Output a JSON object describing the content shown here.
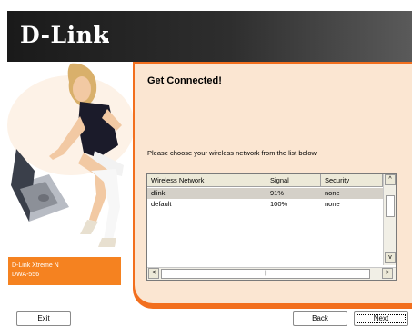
{
  "header": {
    "logo_text": "D-Link"
  },
  "sidebar": {
    "model_line1": "D-Link Xtreme N",
    "model_line2": "DWA-556"
  },
  "main": {
    "title": "Get Connected!",
    "instruction": "Please choose your wireless network from the list below."
  },
  "network_list": {
    "columns": [
      "Wireless Network",
      "Signal",
      "Security"
    ],
    "rows": [
      {
        "name": "dlink",
        "signal": "91%",
        "security": "none",
        "selected": true
      },
      {
        "name": "default",
        "signal": "100%",
        "security": "none",
        "selected": false
      }
    ],
    "scroll_up_glyph": "^",
    "scroll_down_glyph": "v",
    "scroll_left_glyph": "<",
    "scroll_right_glyph": ">",
    "hthumb_glyph": "||"
  },
  "buttons": {
    "exit": "Exit",
    "back": "Back",
    "next": "Next"
  },
  "colors": {
    "accent_orange": "#f26f1e",
    "panel_bg": "#fbe6d2",
    "header_dark": "#1a1a1a"
  }
}
